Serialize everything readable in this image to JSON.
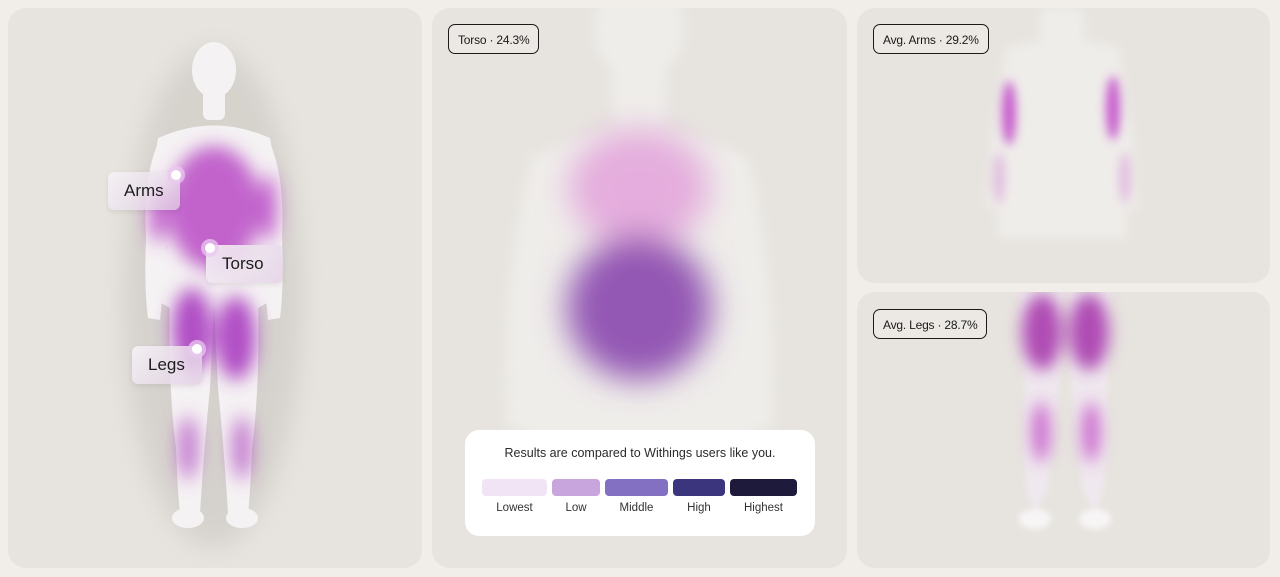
{
  "overview": {
    "labels": {
      "arms": "Arms",
      "torso": "Torso",
      "legs": "Legs"
    }
  },
  "torso_panel": {
    "badge": "Torso · 24.3%",
    "legend": {
      "title": "Results are compared to Withings users like you.",
      "levels": [
        {
          "label": "Lowest",
          "color": "#f1e5f5"
        },
        {
          "label": "Low",
          "color": "#c8a6dd"
        },
        {
          "label": "Middle",
          "color": "#8470c2"
        },
        {
          "label": "High",
          "color": "#3b357d"
        },
        {
          "label": "Highest",
          "color": "#1d1a3b"
        }
      ]
    }
  },
  "arms_panel": {
    "badge": "Avg. Arms · 29.2%"
  },
  "legs_panel": {
    "badge": "Avg. Legs · 28.7%"
  },
  "colors": {
    "background": "#f1eeea",
    "panel": "#e7e4df",
    "heat_magenta": "#b23fc0",
    "heat_purple": "#8a4fb0"
  }
}
